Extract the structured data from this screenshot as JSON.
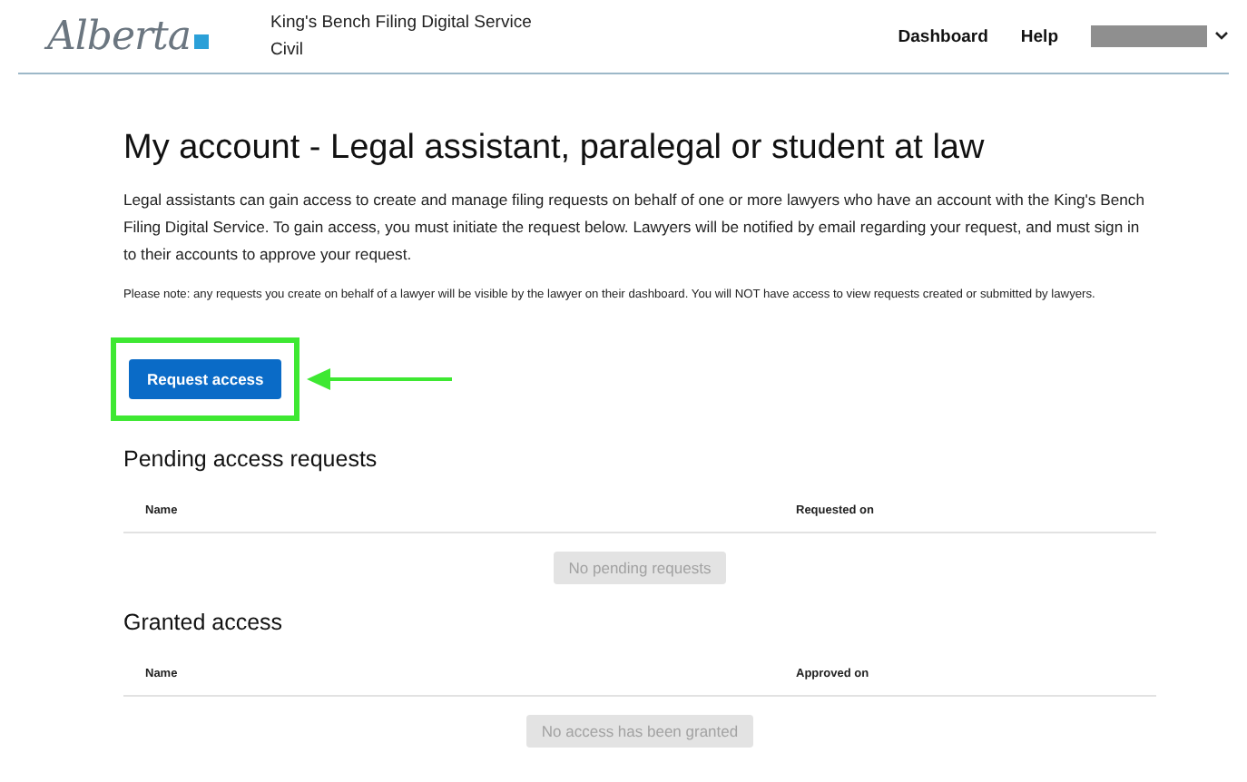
{
  "header": {
    "logo": "Alberta",
    "service_name": "King's Bench Filing Digital Service",
    "service_area": "Civil",
    "nav": [
      "Dashboard",
      "Help"
    ],
    "user_menu": {
      "redacted": true
    }
  },
  "page": {
    "title": "My account - Legal assistant, paralegal or student at law",
    "intro": "Legal assistants can gain access to create and manage filing requests on behalf of one or more lawyers who have an account with the King's Bench Filing Digital Service. To gain access, you must initiate the request below. Lawyers will be notified by email regarding your request, and must sign in to their accounts to approve your request.",
    "note": "Please note: any requests you create on behalf of a lawyer will be visible by the lawyer on their dashboard. You will NOT have access to view requests created or submitted by lawyers.",
    "action": {
      "label": "Request access",
      "highlighted": true
    }
  },
  "sections": [
    {
      "title": "Pending access requests",
      "columns": [
        "Name",
        "Requested on"
      ],
      "empty_message": "No pending requests"
    },
    {
      "title": "Granted access",
      "columns": [
        "Name",
        "Approved on"
      ],
      "empty_message": "No access has been granted"
    }
  ]
}
